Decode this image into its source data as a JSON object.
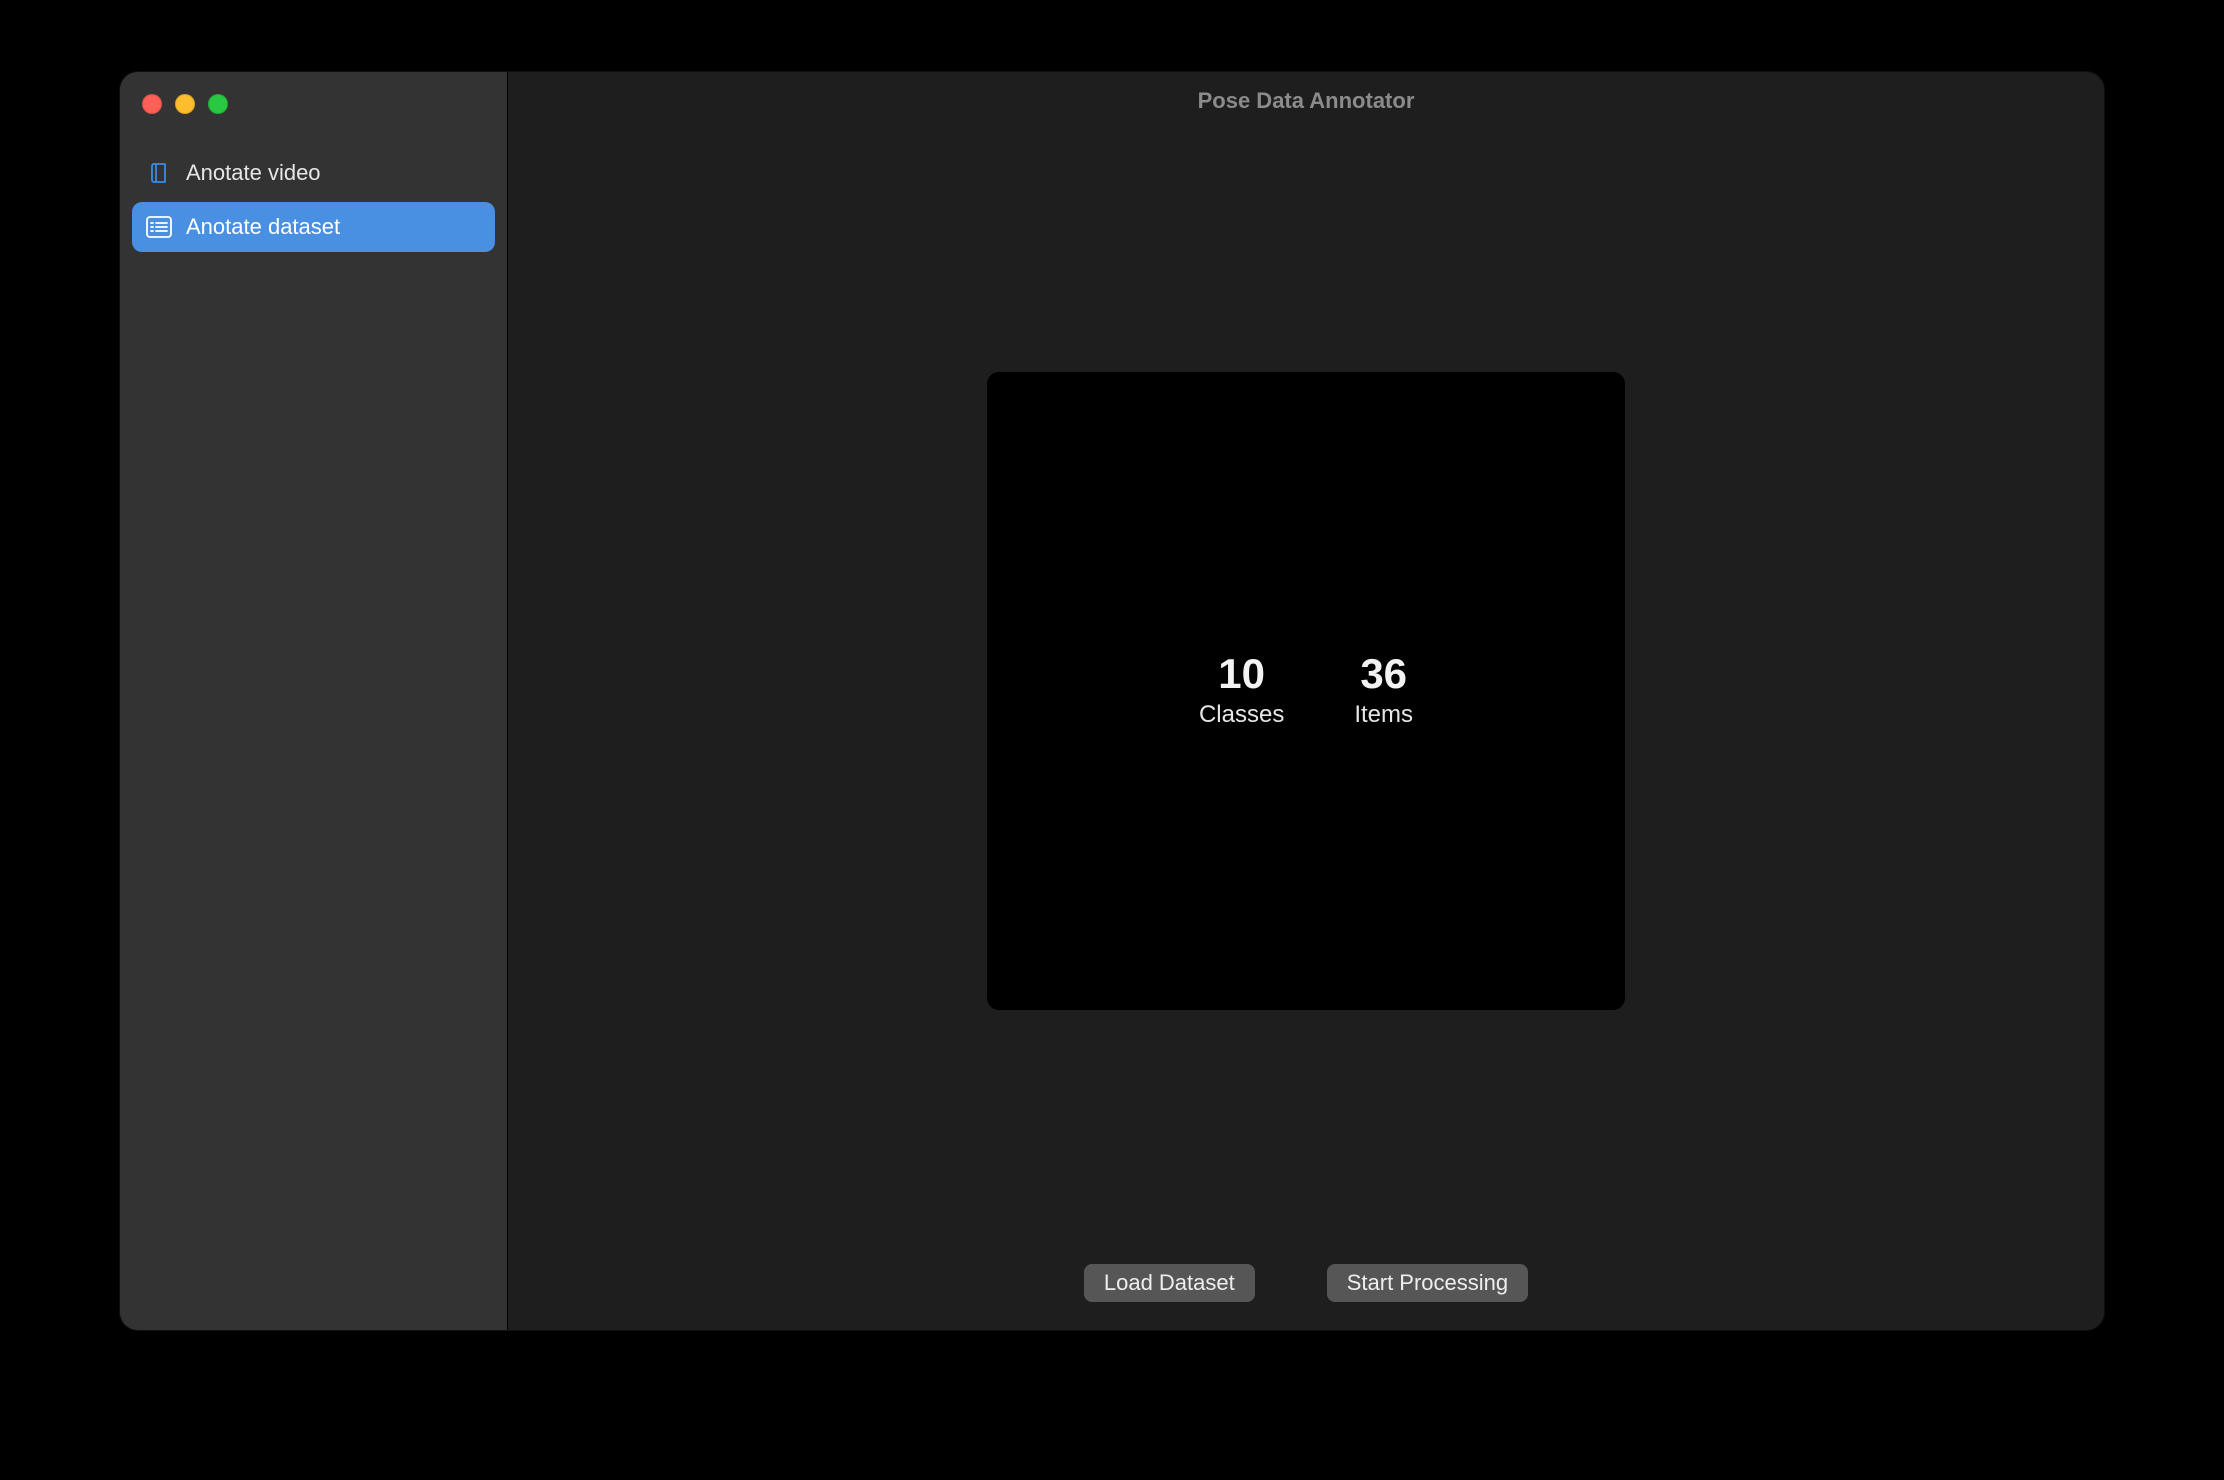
{
  "window": {
    "title": "Pose Data Annotator"
  },
  "sidebar": {
    "items": [
      {
        "icon": "book-icon",
        "label": "Anotate video",
        "active": false
      },
      {
        "icon": "list-icon",
        "label": "Anotate dataset",
        "active": true
      }
    ]
  },
  "stats": {
    "classes": {
      "value": "10",
      "label": "Classes"
    },
    "items": {
      "value": "36",
      "label": "Items"
    }
  },
  "footer": {
    "load_dataset_label": "Load Dataset",
    "start_processing_label": "Start Processing"
  }
}
